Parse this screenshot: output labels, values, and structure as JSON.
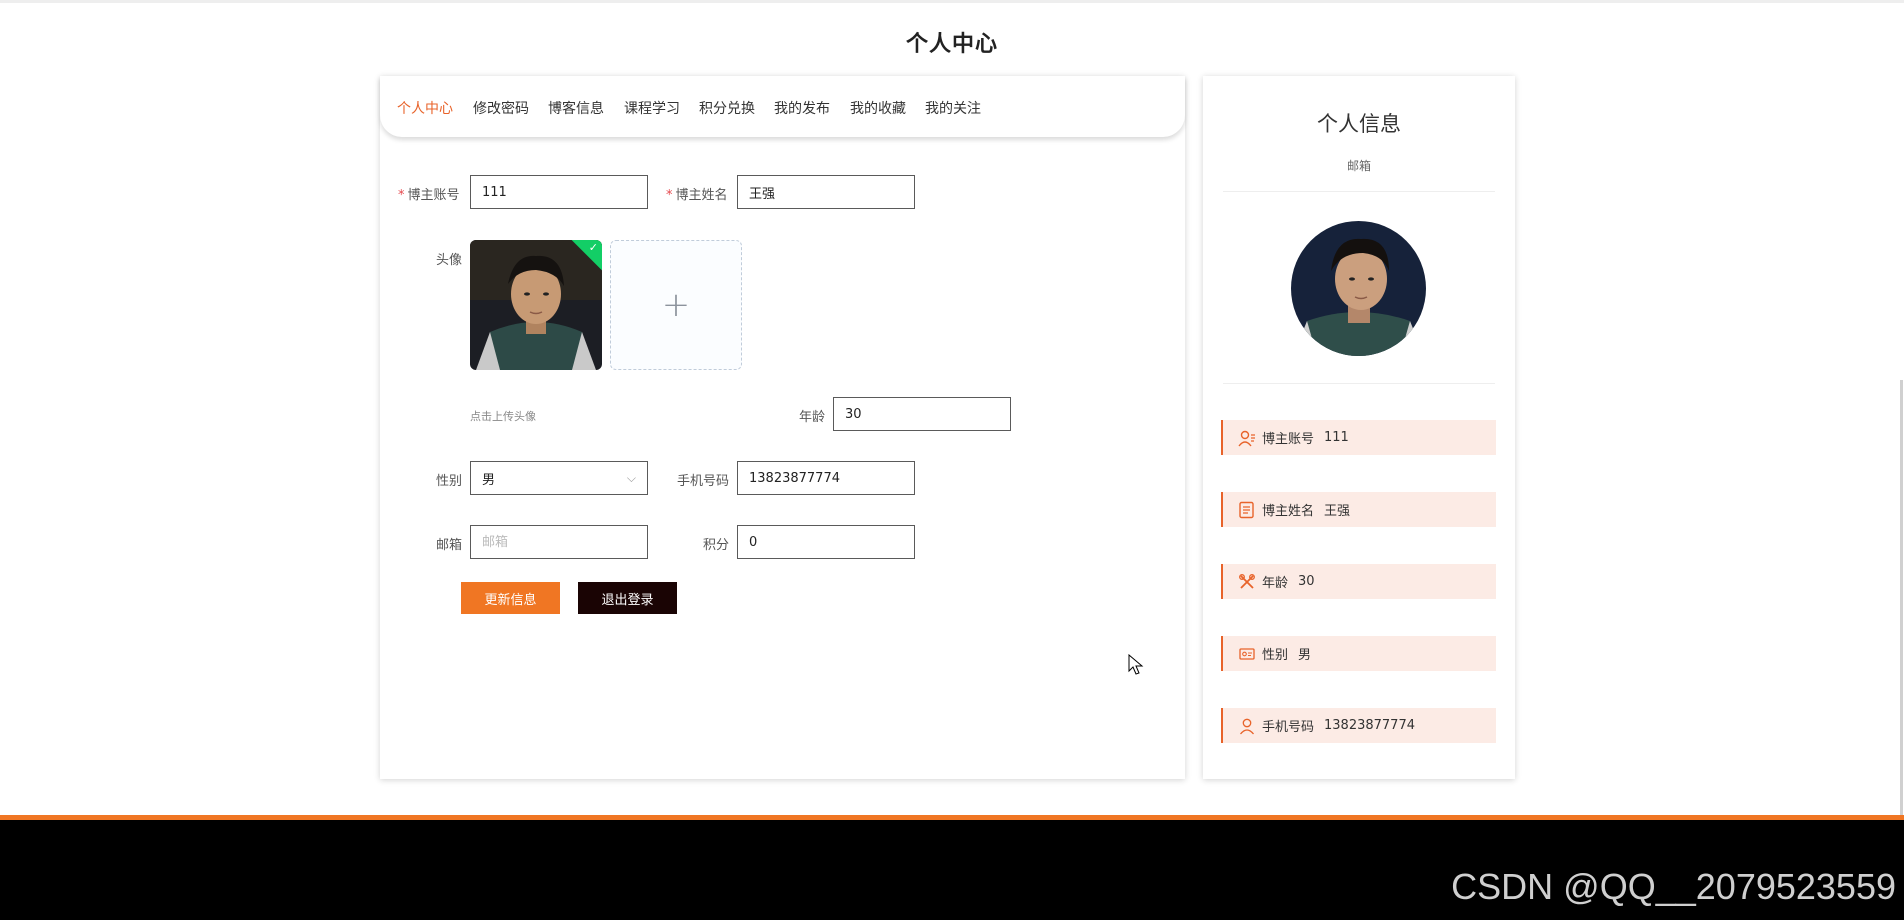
{
  "page_title": "个人中心",
  "tabs": [
    {
      "label": "个人中心",
      "active": true
    },
    {
      "label": "修改密码",
      "active": false
    },
    {
      "label": "博客信息",
      "active": false
    },
    {
      "label": "课程学习",
      "active": false
    },
    {
      "label": "积分兑换",
      "active": false
    },
    {
      "label": "我的发布",
      "active": false
    },
    {
      "label": "我的收藏",
      "active": false
    },
    {
      "label": "我的关注",
      "active": false
    }
  ],
  "form": {
    "required_mark": "*",
    "account": {
      "label": "博主账号",
      "value": "111"
    },
    "name": {
      "label": "博主姓名",
      "value": "王强"
    },
    "avatar": {
      "label": "头像",
      "hint": "点击上传头像",
      "upload_plus": "+"
    },
    "age": {
      "label": "年龄",
      "value": "30"
    },
    "gender": {
      "label": "性别",
      "value": "男"
    },
    "phone": {
      "label": "手机号码",
      "value": "13823877774"
    },
    "email": {
      "label": "邮箱",
      "value": "",
      "placeholder": "邮箱"
    },
    "points": {
      "label": "积分",
      "value": "0"
    }
  },
  "buttons": {
    "update": "更新信息",
    "logout": "退出登录"
  },
  "sidebar": {
    "title": "个人信息",
    "subtitle": "邮箱",
    "rows": [
      {
        "label": "博主账号",
        "value": "111",
        "icon": "user-card-icon"
      },
      {
        "label": "博主姓名",
        "value": "王强",
        "icon": "document-icon"
      },
      {
        "label": "年龄",
        "value": "30",
        "icon": "tools-icon"
      },
      {
        "label": "性别",
        "value": "男",
        "icon": "id-card-icon"
      },
      {
        "label": "手机号码",
        "value": "13823877774",
        "icon": "person-icon"
      }
    ]
  },
  "colors": {
    "accent": "#e8632a",
    "button_update": "#f07623",
    "button_logout": "#1a0404",
    "row_bg": "#fcebe5"
  },
  "watermark": "CSDN @QQ__2079523559"
}
